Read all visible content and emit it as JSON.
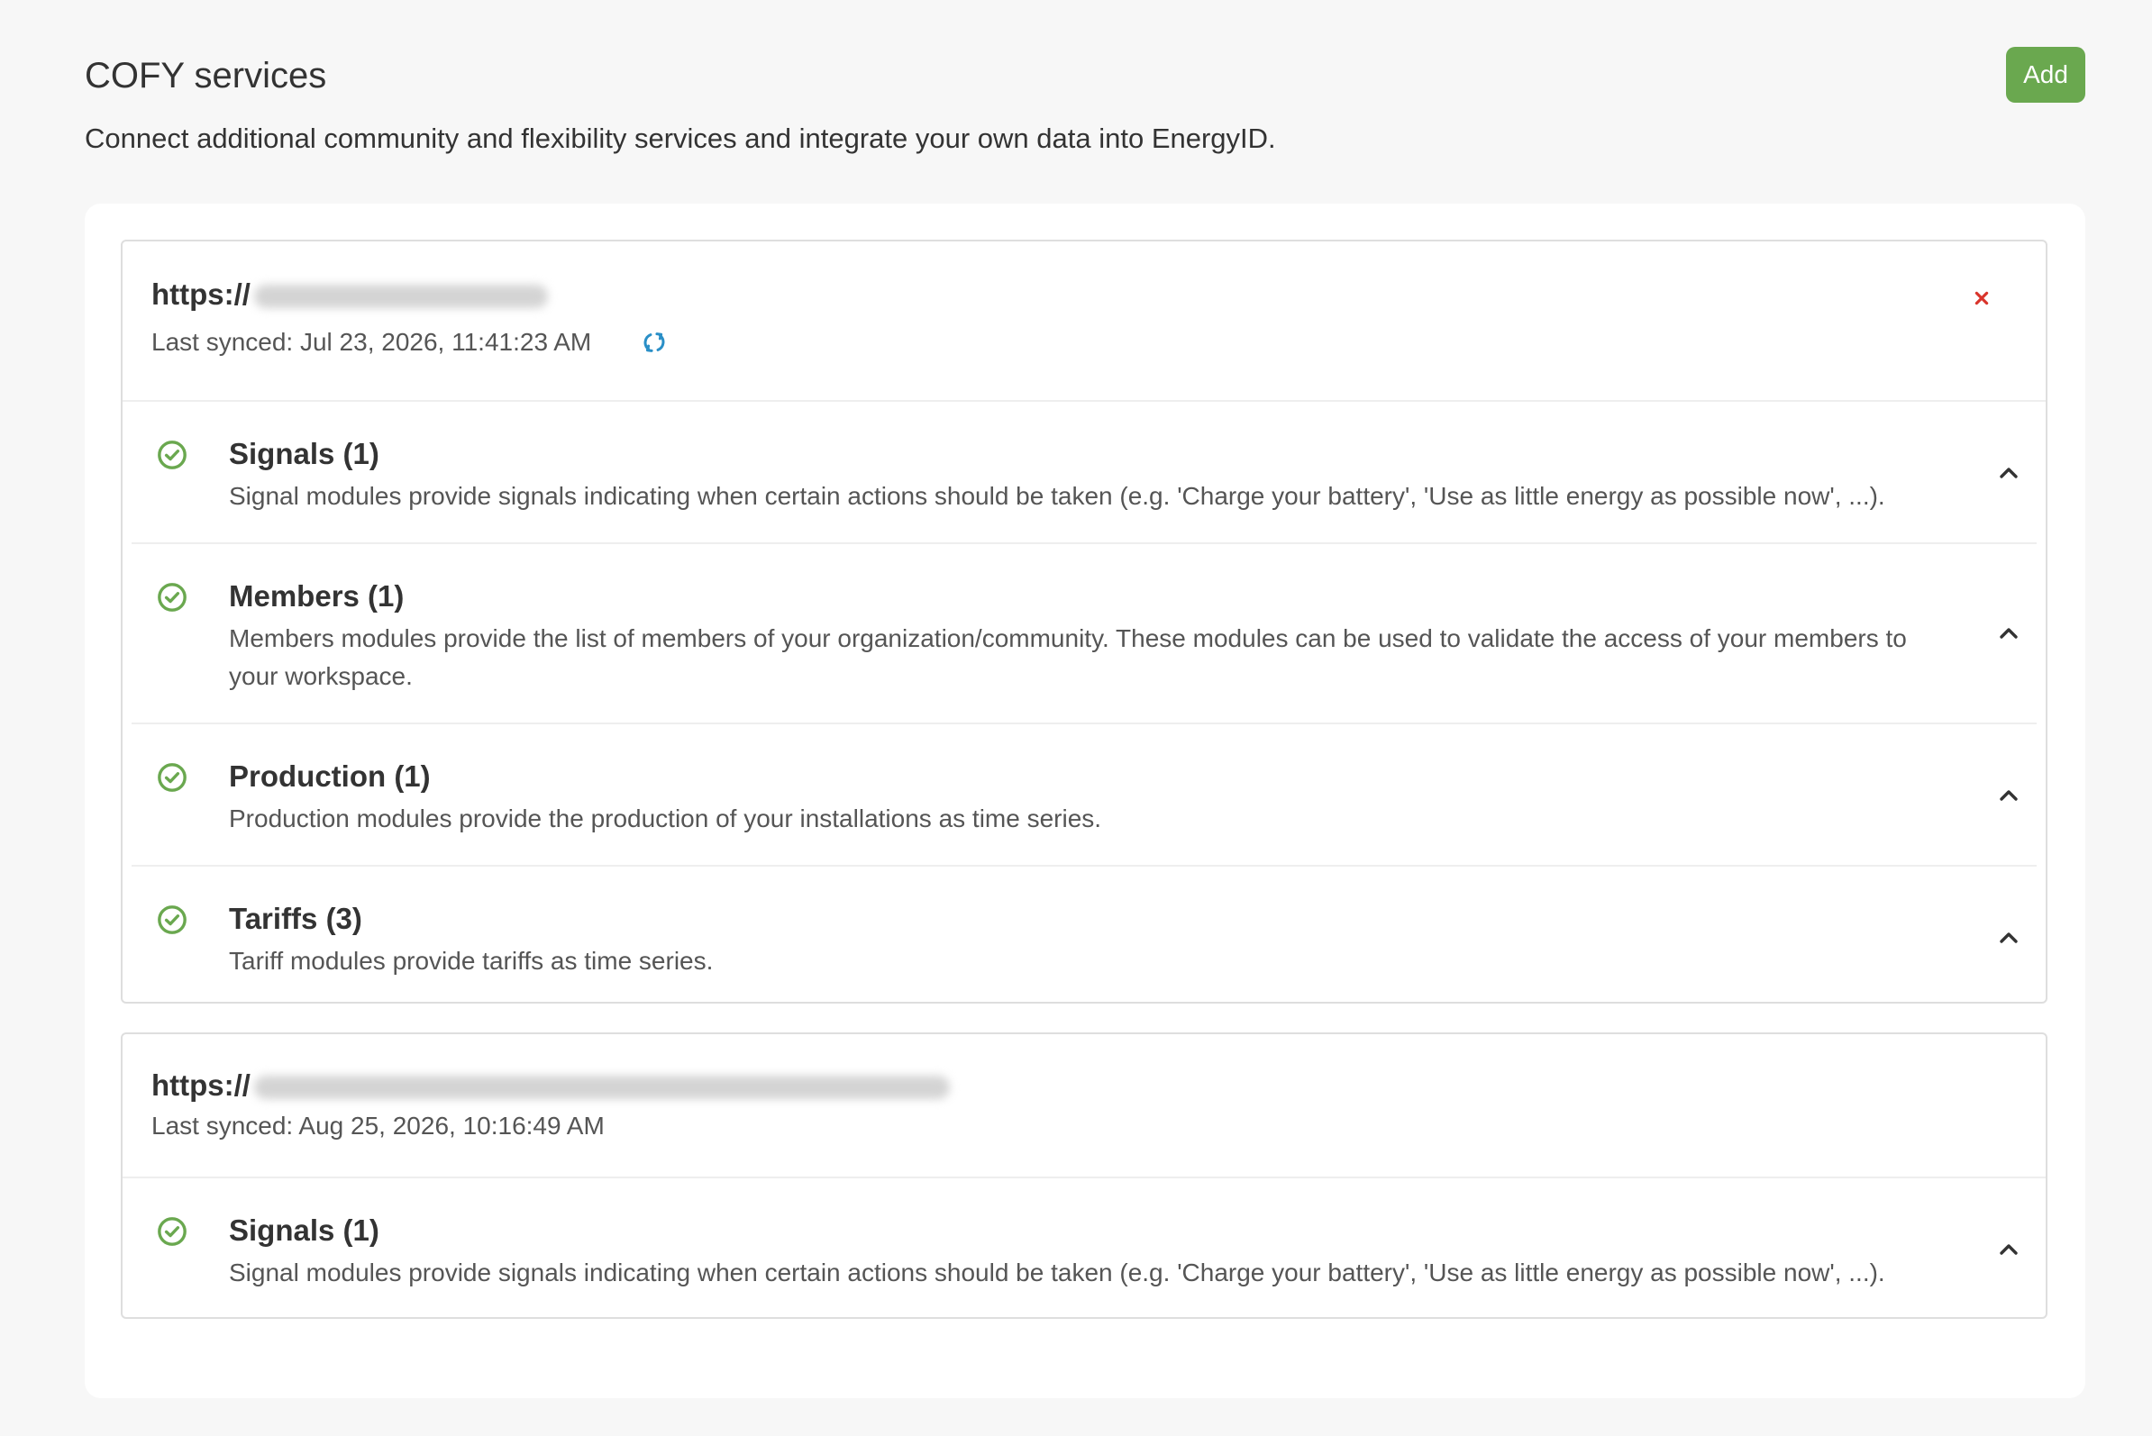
{
  "header": {
    "title": "COFY services",
    "subtitle": "Connect additional community and flexibility services and integrate your own data into EnergyID.",
    "add_label": "Add"
  },
  "colors": {
    "page_background": "#f7f7f7",
    "card_background": "#ffffff",
    "primary_button": "#6aa84f",
    "status_ok": "#6aa84f",
    "sync_icon": "#2a8fc7",
    "remove_icon": "#d9342b",
    "text": "#333333",
    "muted_text": "#555555"
  },
  "services": [
    {
      "url_prefix": "https://",
      "url_redacted": true,
      "last_synced": "Last synced: Jul 23, 2026, 11:41:23 AM",
      "sync_icon": "refresh-icon",
      "remove_icon": "close-icon",
      "modules": [
        {
          "title": "Signals (1)",
          "description": "Signal modules provide signals indicating when certain actions should be taken (e.g. 'Charge your battery', 'Use as little energy as possible now', ...).",
          "status_icon": "check-circle-icon",
          "expand_icon": "chevron-up-icon"
        },
        {
          "title": "Members (1)",
          "description": "Members modules provide the list of members of your organization/community. These modules can be used to validate the access of your members to your workspace.",
          "status_icon": "check-circle-icon",
          "expand_icon": "chevron-up-icon"
        },
        {
          "title": "Production (1)",
          "description": "Production modules provide the production of your installations as time series.",
          "status_icon": "check-circle-icon",
          "expand_icon": "chevron-up-icon"
        },
        {
          "title": "Tariffs (3)",
          "description": "Tariff modules provide tariffs as time series.",
          "status_icon": "check-circle-icon",
          "expand_icon": "chevron-up-icon"
        }
      ]
    },
    {
      "url_prefix": "https://",
      "url_redacted": true,
      "last_synced": "Last synced: Aug 25, 2026, 10:16:49 AM",
      "modules": [
        {
          "title": "Signals (1)",
          "description": "Signal modules provide signals indicating when certain actions should be taken (e.g. 'Charge your battery', 'Use as little energy as possible now', ...).",
          "status_icon": "check-circle-icon",
          "expand_icon": "chevron-up-icon"
        }
      ]
    }
  ]
}
